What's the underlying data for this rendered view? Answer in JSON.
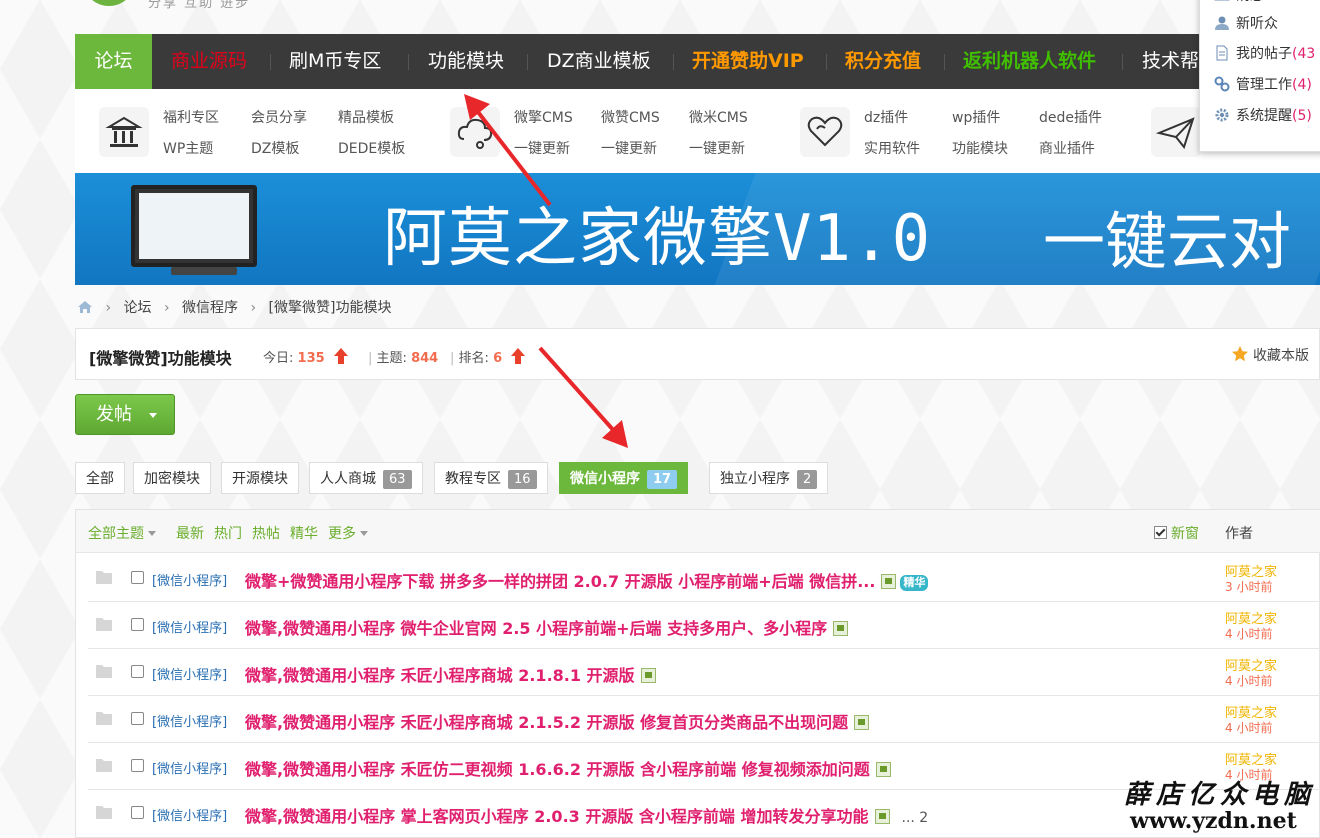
{
  "header": {
    "slogan": "分享 互助 进步"
  },
  "nav": {
    "items": [
      {
        "label": "论坛",
        "color": "#ffffff"
      },
      {
        "label": "商业源码",
        "color": "#e3001b"
      },
      {
        "label": "刷M币专区",
        "color": "#ffffff"
      },
      {
        "label": "功能模块",
        "color": "#ffffff"
      },
      {
        "label": "DZ商业模板",
        "color": "#ffffff"
      },
      {
        "label": "开通赞助VIP",
        "color": "#ff9900"
      },
      {
        "label": "积分充值",
        "color": "#ff9900"
      },
      {
        "label": "返利机器人软件",
        "color": "#3fbf00"
      },
      {
        "label": "技术帮",
        "color": "#ffffff"
      }
    ]
  },
  "subnav": {
    "group1": [
      "福利专区",
      "会员分享",
      "精品模板",
      "WP主题",
      "DZ模板",
      "DEDE模板"
    ],
    "group2": [
      "微擎CMS",
      "微赞CMS",
      "微米CMS",
      "一键更新",
      "一键更新",
      "一键更新"
    ],
    "group3": [
      "dz插件",
      "wp插件",
      "dede插件",
      "实用软件",
      "功能模块",
      "商业插件"
    ]
  },
  "banner": {
    "text": "阿莫之家微擎V1.0",
    "text2": "一键云对"
  },
  "breadcrumb": {
    "items": [
      "论坛",
      "微信程序",
      "[微擎微赞]功能模块"
    ]
  },
  "forum": {
    "title": "[微擎微赞]功能模块",
    "today_label": "今日:",
    "today": "135",
    "threads_label": "主题:",
    "threads": "844",
    "rank_label": "排名:",
    "rank": "6",
    "favorite": "收藏本版"
  },
  "post_button": "发帖",
  "tabs": [
    {
      "label": "全部",
      "count": ""
    },
    {
      "label": "加密模块",
      "count": ""
    },
    {
      "label": "开源模块",
      "count": ""
    },
    {
      "label": "人人商城",
      "count": "63"
    },
    {
      "label": "教程专区",
      "count": "16"
    },
    {
      "label": "微信小程序",
      "count": "17",
      "active": true
    },
    {
      "label": "独立小程序",
      "count": "2"
    }
  ],
  "list": {
    "filters": {
      "all": "全部主题",
      "latest": "最新",
      "hot": "热门",
      "trending": "热帖",
      "digest": "精华",
      "more": "更多"
    },
    "new_window": "新窗",
    "author_header": "作者",
    "threads": [
      {
        "category": "[微信小程序]",
        "title": "微擎+微赞通用小程序下载 拼多多一样的拼团 2.0.7 开源版 小程序前端+后端 微信拼...",
        "digest": "精华",
        "pages": "",
        "author": "阿莫之家",
        "time": "3 小时前"
      },
      {
        "category": "[微信小程序]",
        "title": "微擎,微赞通用小程序 微牛企业官网 2.5 小程序前端+后端 支持多用户、多小程序",
        "digest": "",
        "pages": "",
        "author": "阿莫之家",
        "time": "4 小时前"
      },
      {
        "category": "[微信小程序]",
        "title": "微擎,微赞通用小程序 禾匠小程序商城 2.1.8.1 开源版",
        "digest": "",
        "pages": "",
        "author": "阿莫之家",
        "time": "4 小时前"
      },
      {
        "category": "[微信小程序]",
        "title": "微擎,微赞通用小程序 禾匠小程序商城 2.1.5.2 开源版 修复首页分类商品不出现问题",
        "digest": "",
        "pages": "",
        "author": "阿莫之家",
        "time": "4 小时前"
      },
      {
        "category": "[微信小程序]",
        "title": "微擎,微赞通用小程序 禾匠仿二更视频 1.6.6.2 开源版 含小程序前端 修复视频添加问题",
        "digest": "",
        "pages": "",
        "author": "阿莫之家",
        "time": "4 小时前"
      },
      {
        "category": "[微信小程序]",
        "title": "微擎,微赞通用小程序 掌上客网页小程序 2.0.3 开源版 含小程序前端 增加转发分享功能",
        "digest": "",
        "pages": "... 2",
        "author": "",
        "time": ""
      }
    ]
  },
  "user_menu": {
    "items": [
      {
        "label": "消息",
        "count": "",
        "icon": "mail-icon"
      },
      {
        "label": "新听众",
        "count": "",
        "icon": "user-icon"
      },
      {
        "label": "我的帖子",
        "count": "(43",
        "icon": "document-icon"
      },
      {
        "label": "管理工作",
        "count": "(4)",
        "icon": "link-icon"
      },
      {
        "label": "系统提醒",
        "count": "(5)",
        "icon": "gear-icon"
      }
    ]
  },
  "watermark": {
    "cn": "薛店亿众电脑",
    "url": "www.yzdn.net"
  }
}
